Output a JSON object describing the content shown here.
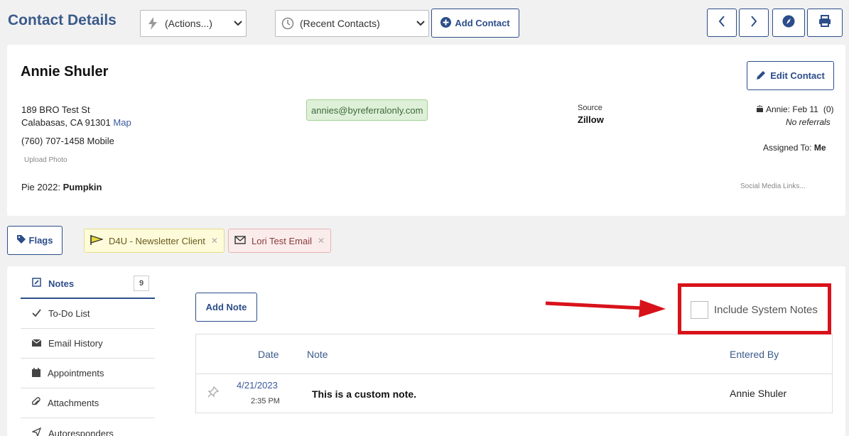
{
  "header": {
    "title": "Contact Details",
    "actions_select": "(Actions...)",
    "recent_select": "(Recent Contacts)",
    "add_contact": "Add Contact"
  },
  "contact": {
    "name": "Annie Shuler",
    "edit_label": "Edit Contact",
    "address_line1": "189 BRO Test St",
    "address_line2": "Calabasas, CA 91301",
    "map_link": "Map",
    "phone": "(760) 707-1458 Mobile",
    "upload_photo": "Upload Photo",
    "pie_label": "Pie 2022:",
    "pie_value": "Pumpkin",
    "email": "annies@byreferralonly.com",
    "source_label": "Source",
    "source_value": "Zillow",
    "birthday": "Annie: Feb 11",
    "referral_count": "(0)",
    "referrals": "No referrals",
    "assigned_label": "Assigned To:",
    "assigned_value": "Me",
    "social_links": "Social Media Links..."
  },
  "flags": {
    "button": "Flags",
    "chips": [
      {
        "label": "D4U - Newsletter Client",
        "bg": "#fdfbd9",
        "border": "#e6dd8a"
      },
      {
        "label": "Lori Test Email",
        "bg": "#fbecec",
        "border": "#e6b3b3"
      }
    ]
  },
  "sidebar": {
    "items": [
      {
        "label": "Notes",
        "icon": "edit-icon",
        "count": "9",
        "active": true
      },
      {
        "label": "To-Do List",
        "icon": "check-icon"
      },
      {
        "label": "Email History",
        "icon": "envelope-icon"
      },
      {
        "label": "Appointments",
        "icon": "calendar-icon"
      },
      {
        "label": "Attachments",
        "icon": "paperclip-icon"
      },
      {
        "label": "Autoresponders",
        "icon": "paper-plane-icon"
      }
    ]
  },
  "notes": {
    "add_note": "Add Note",
    "include_system_notes": "Include System Notes",
    "columns": {
      "date": "Date",
      "note": "Note",
      "entered_by": "Entered By"
    },
    "rows": [
      {
        "date": "4/21/2023",
        "time": "2:35 PM",
        "note": "This is a custom note.",
        "entered_by": "Annie Shuler"
      }
    ]
  },
  "colors": {
    "accent": "#2c4d8a",
    "annotation": "#d8121a"
  }
}
